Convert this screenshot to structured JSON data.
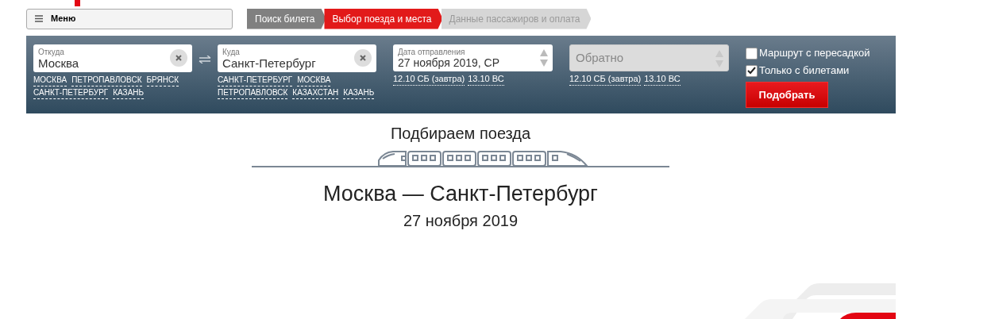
{
  "menu": {
    "label": "Меню"
  },
  "steps": [
    {
      "label": "Поиск билета",
      "selected": false,
      "completed": true
    },
    {
      "label": "Выбор поезда и места",
      "selected": true,
      "completed": false
    },
    {
      "label": "Данные пассажиров и оплата",
      "selected": false,
      "completed": false
    }
  ],
  "search": {
    "from": {
      "label": "Откуда",
      "value": "Москва",
      "suggestions": [
        "МОСКВА",
        "ПЕТРОПАВЛОВСК",
        "БРЯНСК",
        "САНКТ-ПЕТЕРБУРГ",
        "КАЗАНЬ"
      ]
    },
    "to": {
      "label": "Куда",
      "value": "Санкт-Петербург",
      "suggestions": [
        "САНКТ-ПЕТЕРБУРГ",
        "МОСКВА",
        "ПЕТРОПАВЛОВСК",
        "КАЗАХСТАН",
        "КАЗАНЬ"
      ]
    },
    "date": {
      "label": "Дата отправления",
      "value": "27 ноября 2019, СР",
      "disabled": false,
      "quick_dates": [
        "12.10 СБ (завтра)",
        "13.10 ВС"
      ]
    },
    "return": {
      "placeholder": "Обратно",
      "disabled": true,
      "quick_dates": [
        "12.10 СБ (завтра)",
        "13.10 ВС"
      ]
    },
    "options": [
      {
        "label": "Маршрут с пересадкой",
        "checked": false
      },
      {
        "label": "Только с билетами",
        "checked": true
      }
    ],
    "submit": "Подобрать"
  },
  "loading": {
    "title": "Подбираем поезда",
    "route": "Москва — Санкт-Петербург",
    "date": "27 ноября 2019"
  }
}
